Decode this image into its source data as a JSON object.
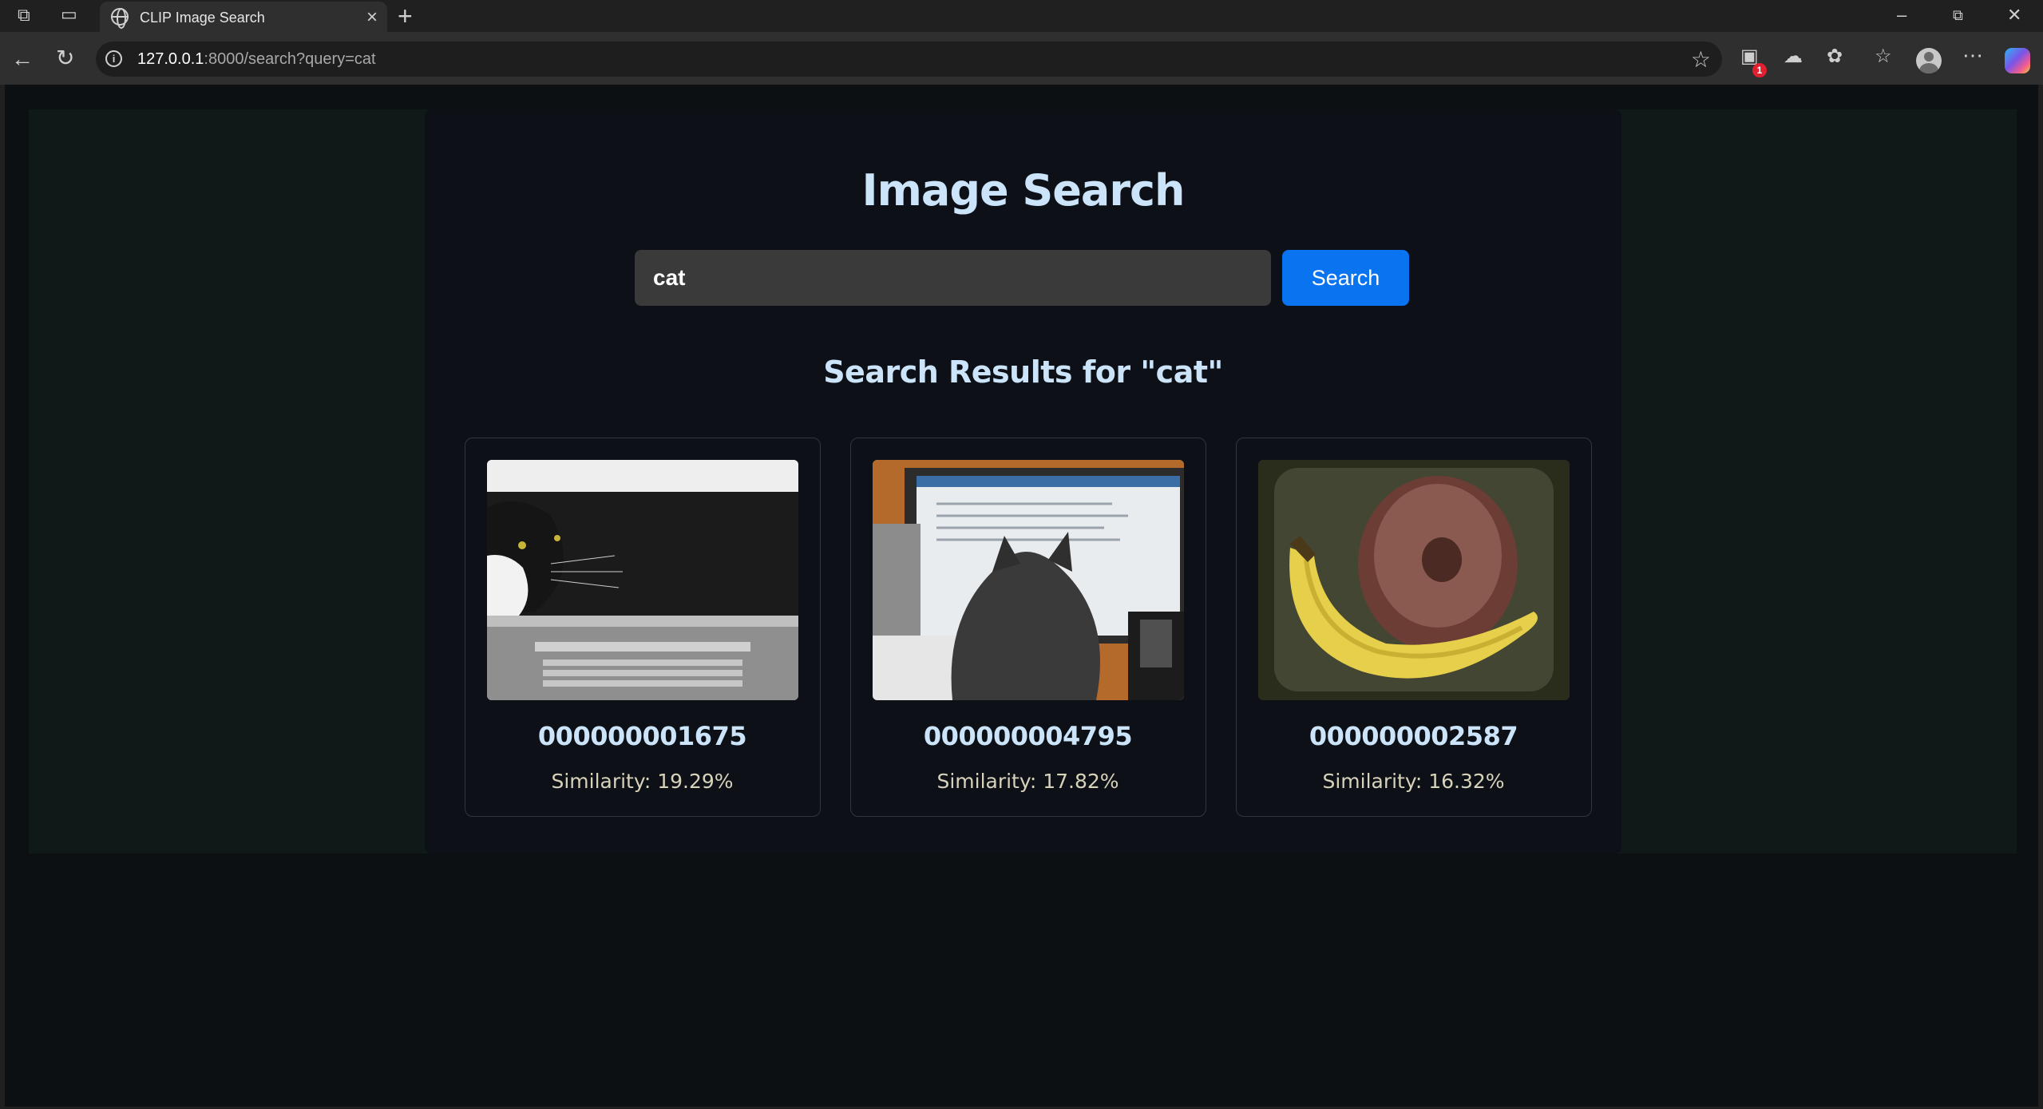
{
  "browser": {
    "tab_title": "CLIP Image Search",
    "url_host": "127.0.0.1",
    "url_rest": ":8000/search?query=cat",
    "notification_count": "1"
  },
  "page": {
    "title": "Image Search",
    "search_value": "cat",
    "search_button_label": "Search",
    "results_heading": "Search Results for \"cat\""
  },
  "results": [
    {
      "id": "000000001675",
      "similarity": "Similarity: 19.29%",
      "image_desc": "black-and-white-cat-on-laptop"
    },
    {
      "id": "000000004795",
      "similarity": "Similarity: 17.82%",
      "image_desc": "cat-in-front-of-monitor"
    },
    {
      "id": "000000002587",
      "similarity": "Similarity: 16.32%",
      "image_desc": "banana-and-donut-in-bag"
    }
  ],
  "colors": {
    "accent": "#0a73f0",
    "heading": "#cbe4f9",
    "similarity_text": "#d8d2bb",
    "page_bg": "#0c1013"
  }
}
